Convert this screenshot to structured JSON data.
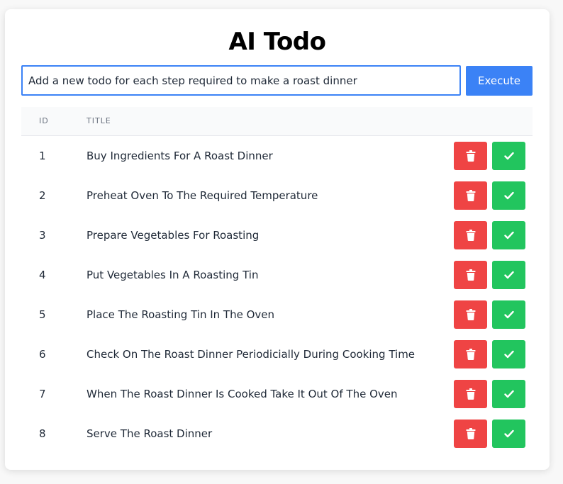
{
  "app": {
    "title": "AI Todo"
  },
  "prompt": {
    "value": "Add a new todo for each step required to make a roast dinner",
    "execute_label": "Execute"
  },
  "table": {
    "headers": {
      "id": "ID",
      "title": "TITLE"
    },
    "rows": [
      {
        "id": "1",
        "title": "Buy Ingredients For A Roast Dinner"
      },
      {
        "id": "2",
        "title": "Preheat Oven To The Required Temperature"
      },
      {
        "id": "3",
        "title": "Prepare Vegetables For Roasting"
      },
      {
        "id": "4",
        "title": "Put Vegetables In A Roasting Tin"
      },
      {
        "id": "5",
        "title": "Place The Roasting Tin In The Oven"
      },
      {
        "id": "6",
        "title": "Check On The Roast Dinner Periodicially During Cooking Time"
      },
      {
        "id": "7",
        "title": "When The Roast Dinner Is Cooked Take It Out Of The Oven"
      },
      {
        "id": "8",
        "title": "Serve The Roast Dinner"
      }
    ],
    "row_actions": {
      "delete_icon": "trash-icon",
      "complete_icon": "check-icon"
    }
  },
  "colors": {
    "accent": "#3b82f6",
    "delete": "#ef4444",
    "complete": "#22c55e"
  }
}
